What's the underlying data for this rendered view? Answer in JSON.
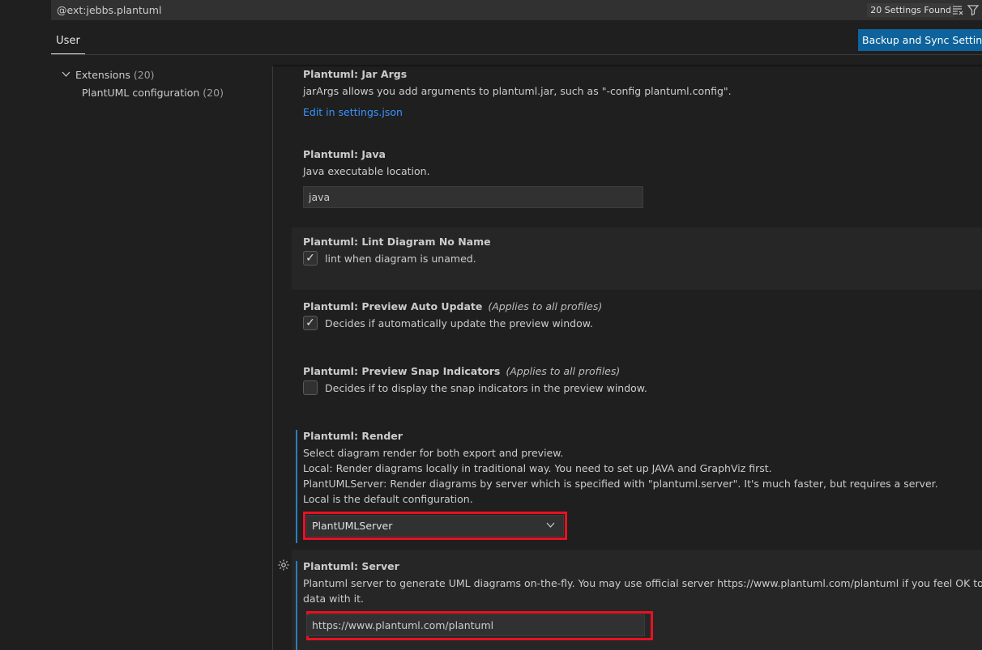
{
  "search": {
    "value": "@ext:jebbs.plantuml",
    "result_count": "20 Settings Found",
    "clear_icon": "clear-filter-icon",
    "filter_icon": "filter-icon"
  },
  "header": {
    "tab_user": "User",
    "sync_button": "Backup and Sync Settings"
  },
  "toc": {
    "extensions_label": "Extensions",
    "extensions_count": "(20)",
    "child_label": "PlantUML configuration",
    "child_count": "(20)"
  },
  "settings": {
    "jar_args": {
      "category": "Plantuml: ",
      "name": "Jar Args",
      "description": "jarArgs allows you add arguments to plantuml.jar, such as \"-config plantuml.config\".",
      "link": "Edit in settings.json"
    },
    "java": {
      "category": "Plantuml: ",
      "name": "Java",
      "description": "Java executable location.",
      "value": "java"
    },
    "lint": {
      "category": "Plantuml: ",
      "name": "Lint Diagram No Name",
      "description": "lint when diagram is unamed.",
      "checked": true
    },
    "preview_auto_update": {
      "category": "Plantuml: ",
      "name": "Preview Auto Update",
      "scope": "(Applies to all profiles)",
      "description": "Decides if automatically update the preview window.",
      "checked": true
    },
    "preview_snap": {
      "category": "Plantuml: ",
      "name": "Preview Snap Indicators",
      "scope": "(Applies to all profiles)",
      "description": "Decides if to display the snap indicators in the preview window.",
      "checked": false
    },
    "render": {
      "category": "Plantuml: ",
      "name": "Render",
      "description_lines": [
        "Select diagram render for both export and preview.",
        "Local: Render diagrams locally in traditional way. You need to set up JAVA and GraphViz first.",
        "PlantUMLServer: Render diagrams by server which is specified with \"plantuml.server\". It's much faster, but requires a server.",
        "Local is the default configuration."
      ],
      "selected": "PlantUMLServer"
    },
    "server": {
      "category": "Plantuml: ",
      "name": "Server",
      "description_lines": [
        "Plantuml server to generate UML diagrams on-the-fly. You may use official server https://www.plantuml.com/plantuml if you feel OK to share",
        "data with it."
      ],
      "value": "https://www.plantuml.com/plantuml"
    }
  },
  "colors": {
    "background": "#1f1f1f",
    "accent": "#0e639c",
    "link": "#3794ff",
    "highlight_border": "#e81123"
  }
}
